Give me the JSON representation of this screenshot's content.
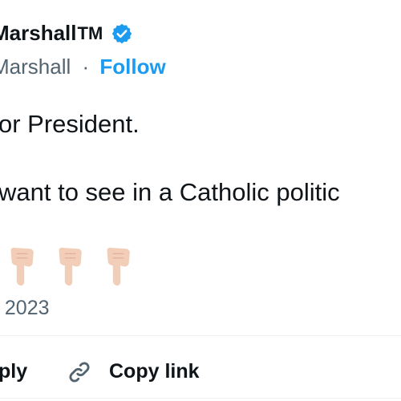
{
  "author": {
    "display_name": "Marshall",
    "tm": "TM",
    "handle": "Marshall",
    "separator": "·",
    "follow_label": "Follow",
    "verified_color": "#1d9bf0"
  },
  "tweet": {
    "lines": [
      "or President.",
      "want to see in a Catholic politic"
    ],
    "emoji_icons": [
      "backhand-index-pointing-down",
      "backhand-index-pointing-down",
      "backhand-index-pointing-down"
    ],
    "timestamp": ", 2023"
  },
  "actions": {
    "reply_label": "ply",
    "copy_link_label": "Copy link"
  },
  "colors": {
    "text": "#0f1419",
    "secondary": "#536471",
    "accent": "#1d9bf0",
    "emoji_skin": "#f2cdb8"
  }
}
